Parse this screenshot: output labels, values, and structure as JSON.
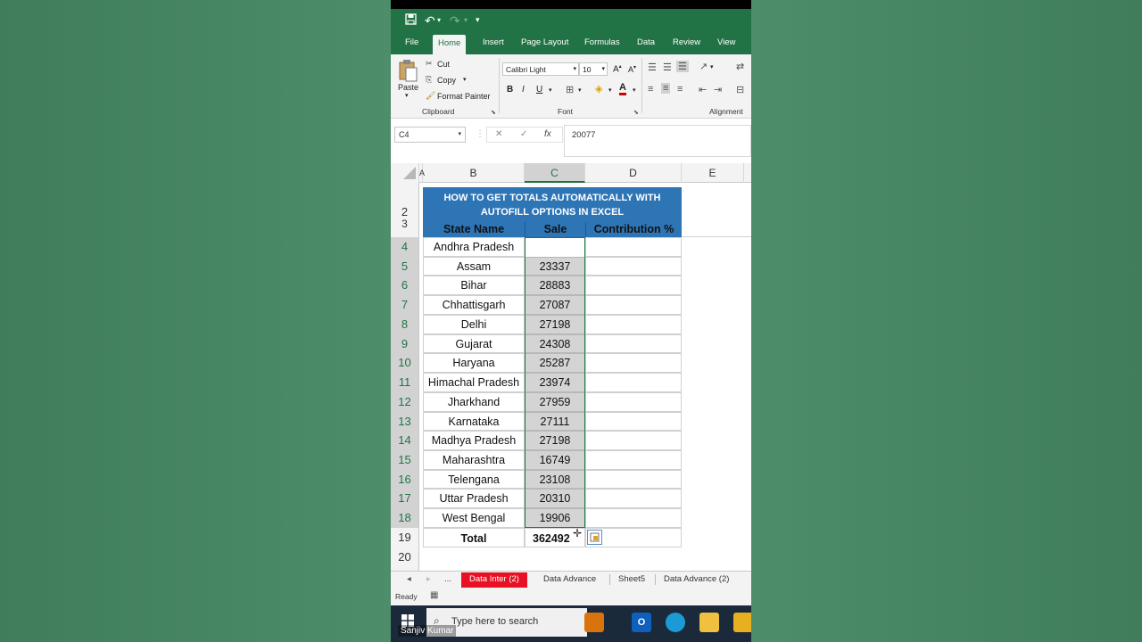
{
  "quick_access": {
    "save_icon": "save-icon",
    "undo_icon": "undo-icon",
    "redo_icon": "redo-icon",
    "customize": "▾"
  },
  "ribbon_tabs": [
    "File",
    "Home",
    "Insert",
    "Page Layout",
    "Formulas",
    "Data",
    "Review",
    "View"
  ],
  "ribbon": {
    "clipboard": {
      "paste": "Paste",
      "cut": "Cut",
      "copy": "Copy",
      "format_painter": "Format Painter",
      "label": "Clipboard"
    },
    "font": {
      "font_name": "Calibri Light",
      "font_size": "10",
      "bold": "B",
      "italic": "I",
      "underline": "U",
      "label": "Font"
    },
    "alignment": {
      "label": "Alignment"
    }
  },
  "formula_bar": {
    "name_box": "C4",
    "formula": "20077",
    "cancel": "✕",
    "enter": "✓",
    "fx": "fx"
  },
  "columns": [
    "B",
    "C",
    "D",
    "E"
  ],
  "title": {
    "line1": "HOW TO GET TOTALS AUTOMATICALLY WITH",
    "line2": "AUTOFILL OPTIONS IN EXCEL"
  },
  "headers": {
    "state": "State Name",
    "sale": "Sale",
    "contribution": "Contribution %"
  },
  "rows": [
    {
      "row": "4",
      "state": "Andhra Pradesh",
      "sale": "20077"
    },
    {
      "row": "5",
      "state": "Assam",
      "sale": "23337"
    },
    {
      "row": "6",
      "state": "Bihar",
      "sale": "28883"
    },
    {
      "row": "7",
      "state": "Chhattisgarh",
      "sale": "27087"
    },
    {
      "row": "8",
      "state": "Delhi",
      "sale": "27198"
    },
    {
      "row": "9",
      "state": "Gujarat",
      "sale": "24308"
    },
    {
      "row": "10",
      "state": "Haryana",
      "sale": "25287"
    },
    {
      "row": "11",
      "state": "Himachal Pradesh",
      "sale": "23974"
    },
    {
      "row": "12",
      "state": "Jharkhand",
      "sale": "27959"
    },
    {
      "row": "13",
      "state": "Karnataka",
      "sale": "27111"
    },
    {
      "row": "14",
      "state": "Madhya Pradesh",
      "sale": "27198"
    },
    {
      "row": "15",
      "state": "Maharashtra",
      "sale": "16749"
    },
    {
      "row": "16",
      "state": "Telengana",
      "sale": "23108"
    },
    {
      "row": "17",
      "state": "Uttar Pradesh",
      "sale": "20310"
    },
    {
      "row": "18",
      "state": "West Bengal",
      "sale": "19906"
    }
  ],
  "total": {
    "row": "19",
    "label": "Total",
    "value": "362492"
  },
  "row_labels": {
    "r2": "2",
    "r3": "3",
    "r20": "20"
  },
  "sheet_tabs": {
    "nav_prev": "◂",
    "nav_next": "▸",
    "more": "...",
    "active": "Data Inter (2)",
    "tab2": "Data Advance",
    "tab3": "Sheet5",
    "tab4": "Data Advance (2)"
  },
  "status": {
    "text": "Ready"
  },
  "taskbar": {
    "search_placeholder": "Type here to search"
  },
  "creator": "Sanjiv Kumar",
  "colors": {
    "excel_green": "#217346",
    "header_blue": "#2e75b6",
    "active_tab_red": "#e81123"
  }
}
